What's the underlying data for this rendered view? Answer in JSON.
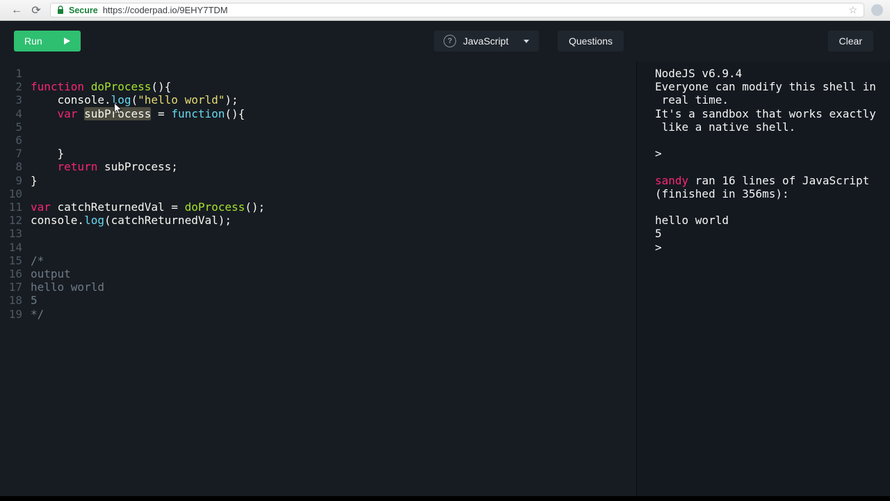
{
  "browser": {
    "secure_label": "Secure",
    "url": "https://coderpad.io/9EHY7TDM"
  },
  "toolbar": {
    "run_label": "Run",
    "language_label": "JavaScript",
    "questions_label": "Questions",
    "clear_label": "Clear"
  },
  "colors": {
    "accent_green": "#2fbf71",
    "keyword": "#f92672",
    "function_name": "#a6e22e",
    "builtin": "#66d9ef",
    "string": "#e6db74",
    "comment": "#6e7b87",
    "plain_text": "#f8f8f2",
    "username": "#f92672",
    "secure_green": "#188038",
    "editor_background": "#171c22"
  },
  "editor": {
    "lines": [
      {
        "n": 1,
        "tokens": []
      },
      {
        "n": 2,
        "tokens": [
          {
            "t": "function",
            "c": "kw"
          },
          {
            "t": " ",
            "c": "p"
          },
          {
            "t": "doProcess",
            "c": "fn"
          },
          {
            "t": "(){",
            "c": "p"
          }
        ]
      },
      {
        "n": 3,
        "tokens": [
          {
            "t": "    console.",
            "c": "p"
          },
          {
            "t": "log",
            "c": "bi"
          },
          {
            "t": "(",
            "c": "p"
          },
          {
            "t": "\"hello world\"",
            "c": "st"
          },
          {
            "t": ");",
            "c": "p"
          }
        ]
      },
      {
        "n": 4,
        "tokens": [
          {
            "t": "    ",
            "c": "p"
          },
          {
            "t": "var",
            "c": "kw"
          },
          {
            "t": " ",
            "c": "p"
          },
          {
            "t": "subProcess",
            "c": "hl"
          },
          {
            "t": " = ",
            "c": "p"
          },
          {
            "t": "function",
            "c": "bi"
          },
          {
            "t": "(){",
            "c": "p"
          }
        ]
      },
      {
        "n": 5,
        "tokens": []
      },
      {
        "n": 6,
        "tokens": []
      },
      {
        "n": 7,
        "tokens": [
          {
            "t": "    }",
            "c": "p"
          }
        ]
      },
      {
        "n": 8,
        "tokens": [
          {
            "t": "    ",
            "c": "p"
          },
          {
            "t": "return",
            "c": "kw"
          },
          {
            "t": " subProcess;",
            "c": "p"
          }
        ]
      },
      {
        "n": 9,
        "tokens": [
          {
            "t": "}",
            "c": "p"
          }
        ]
      },
      {
        "n": 10,
        "tokens": []
      },
      {
        "n": 11,
        "tokens": [
          {
            "t": "var",
            "c": "kw"
          },
          {
            "t": " catchReturnedVal = ",
            "c": "p"
          },
          {
            "t": "doProcess",
            "c": "fn"
          },
          {
            "t": "();",
            "c": "p"
          }
        ]
      },
      {
        "n": 12,
        "tokens": [
          {
            "t": "console.",
            "c": "p"
          },
          {
            "t": "log",
            "c": "bi"
          },
          {
            "t": "(catchReturnedVal);",
            "c": "p"
          }
        ]
      },
      {
        "n": 13,
        "tokens": []
      },
      {
        "n": 14,
        "tokens": []
      },
      {
        "n": 15,
        "tokens": [
          {
            "t": "/*",
            "c": "cm"
          }
        ]
      },
      {
        "n": 16,
        "tokens": [
          {
            "t": "output",
            "c": "cm"
          }
        ]
      },
      {
        "n": 17,
        "tokens": [
          {
            "t": "hello world",
            "c": "cm"
          }
        ]
      },
      {
        "n": 18,
        "tokens": [
          {
            "t": "5",
            "c": "cm"
          }
        ]
      },
      {
        "n": 19,
        "tokens": [
          {
            "t": "*/",
            "c": "cm"
          }
        ]
      }
    ]
  },
  "console": {
    "lines": [
      [
        {
          "t": "NodeJS v6.9.4",
          "c": "p"
        }
      ],
      [
        {
          "t": "Everyone can modify this shell in",
          "c": "p"
        }
      ],
      [
        {
          "t": " real time.",
          "c": "p"
        }
      ],
      [
        {
          "t": "It's a sandbox that works exactly",
          "c": "p"
        }
      ],
      [
        {
          "t": " like a native shell.",
          "c": "p"
        }
      ],
      [],
      [
        {
          "t": ">",
          "c": "p"
        }
      ],
      [],
      [
        {
          "t": "sandy",
          "c": "user"
        },
        {
          "t": " ran 16 lines of JavaScript",
          "c": "p"
        }
      ],
      [
        {
          "t": "(finished in 356ms):",
          "c": "p"
        }
      ],
      [],
      [
        {
          "t": "hello world",
          "c": "p"
        }
      ],
      [
        {
          "t": "5",
          "c": "p"
        }
      ],
      [
        {
          "t": ">",
          "c": "p"
        }
      ]
    ]
  }
}
